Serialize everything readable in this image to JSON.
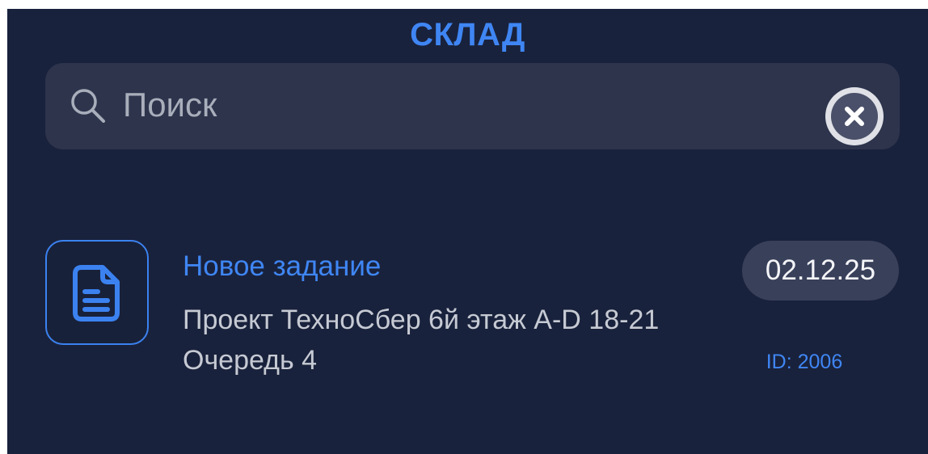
{
  "header": {
    "title": "СКЛАД"
  },
  "search": {
    "placeholder": "Поиск",
    "value": "",
    "search_icon": "magnifier-icon",
    "clear_icon": "clear-circle-x-icon"
  },
  "tasks": [
    {
      "icon": "document-icon",
      "title": "Новое задание",
      "description": "Проект ТехноСбер 6й этаж A-D 18-21 Очередь 4",
      "date": "02.12.25",
      "id_text": "ID: 2006"
    }
  ],
  "colors": {
    "background": "#19223c",
    "accent": "#3f86f4",
    "search_bg": "#2d344c",
    "badge_bg": "#39405a"
  }
}
